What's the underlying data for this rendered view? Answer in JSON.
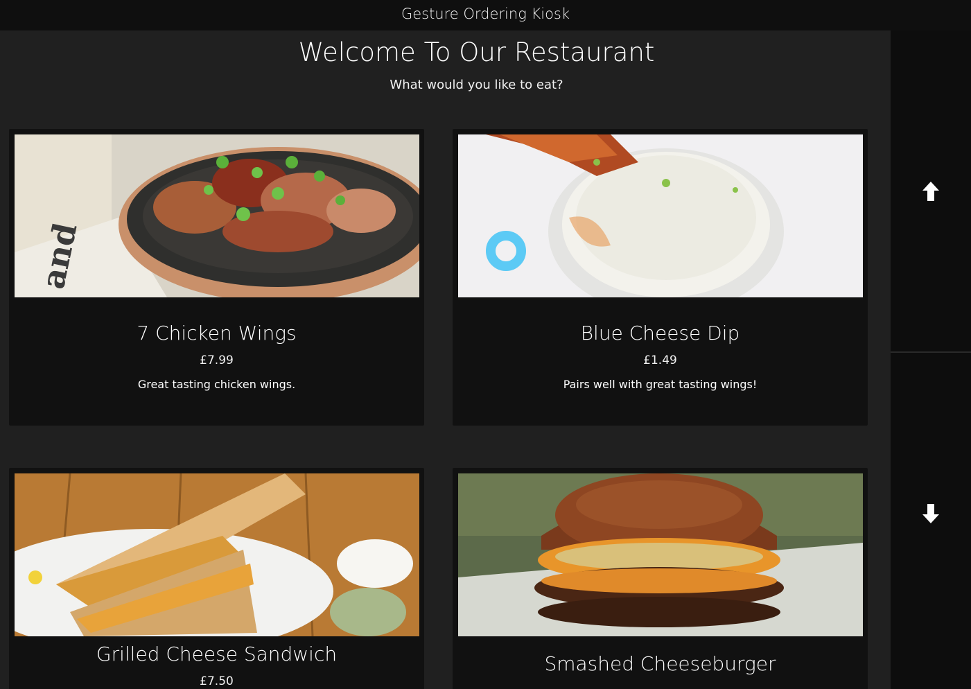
{
  "window": {
    "title": "Gesture Ordering Kiosk"
  },
  "header": {
    "welcome": "Welcome To Our Restaurant",
    "prompt": "What would you like to eat?"
  },
  "menu_items": [
    {
      "name": "7 Chicken Wings",
      "price": "£7.99",
      "description": "Great tasting chicken wings.",
      "image": "chicken-wings-photo"
    },
    {
      "name": "Blue Cheese Dip",
      "price": "£1.49",
      "description": "Pairs well with great tasting wings!",
      "image": "blue-cheese-dip-photo"
    },
    {
      "name": "Grilled Cheese Sandwich",
      "price": "£7.50",
      "description": "",
      "image": "grilled-cheese-photo"
    },
    {
      "name": "Smashed Cheeseburger",
      "price": "",
      "description": "",
      "image": "cheeseburger-photo"
    }
  ],
  "sidebar": {
    "scroll_up_icon": "arrow-up-icon",
    "scroll_down_icon": "arrow-down-icon"
  },
  "colors": {
    "cursor": "#5ccaf5",
    "card": "#111111",
    "background": "#202020",
    "titlebar": "#0f0f0f"
  }
}
